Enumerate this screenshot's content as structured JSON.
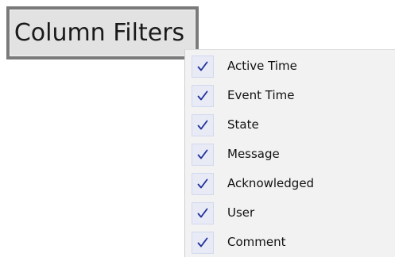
{
  "filter_button": {
    "label": "Column Filters"
  },
  "menu": {
    "items": [
      {
        "label": "Active Time",
        "checked": true
      },
      {
        "label": "Event Time",
        "checked": true
      },
      {
        "label": "State",
        "checked": true
      },
      {
        "label": "Message",
        "checked": true
      },
      {
        "label": "Acknowledged",
        "checked": true
      },
      {
        "label": "User",
        "checked": true
      },
      {
        "label": "Comment",
        "checked": true
      }
    ]
  },
  "colors": {
    "check_mark": "#1f2f9a",
    "check_box_bg": "#e8ebf6",
    "menu_bg": "#f2f2f2",
    "button_bg": "#e2e2e2",
    "button_border": "#7a7a7a"
  },
  "icons": {
    "check": "check-icon"
  }
}
